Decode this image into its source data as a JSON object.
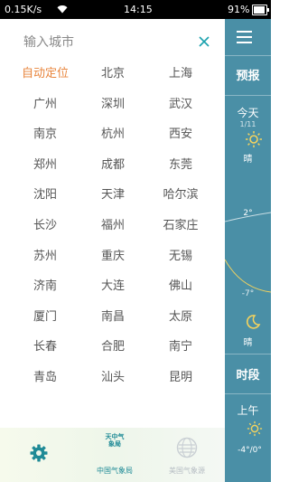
{
  "status": {
    "speed": "0.15K/s",
    "time": "14:15",
    "battery_text": "91%",
    "battery_level": 0.91
  },
  "search": {
    "placeholder": "输入城市"
  },
  "cities": [
    "自动定位",
    "北京",
    "上海",
    "广州",
    "深圳",
    "武汉",
    "南京",
    "杭州",
    "西安",
    "郑州",
    "成都",
    "东莞",
    "沈阳",
    "天津",
    "哈尔滨",
    "长沙",
    "福州",
    "石家庄",
    "苏州",
    "重庆",
    "无锡",
    "济南",
    "大连",
    "佛山",
    "厦门",
    "南昌",
    "太原",
    "长春",
    "合肥",
    "南宁",
    "青岛",
    "汕头",
    "昆明"
  ],
  "bottom": {
    "cma_logo_text": "天中气象局",
    "cma_label": "中国气象局",
    "us_label": "美国气象源"
  },
  "side": {
    "forecast_title": "预报",
    "today": "今天",
    "date": "1/11",
    "condition_day": "晴",
    "temp_high": "2°",
    "temp_low": "-7°",
    "condition_night": "晴",
    "hourly_title": "时段",
    "am": "上午",
    "am_temp": "-4°/0°"
  },
  "colors": {
    "accent_orange": "#e8843b",
    "teal": "#1aa1ad",
    "side_blue": "#4a8fa6",
    "sun_yellow": "#f4d35e"
  },
  "icons": {
    "close": "close-icon",
    "gear": "gear-icon",
    "menu": "menu-icon",
    "sun": "sun-icon",
    "moon": "moon-icon"
  }
}
